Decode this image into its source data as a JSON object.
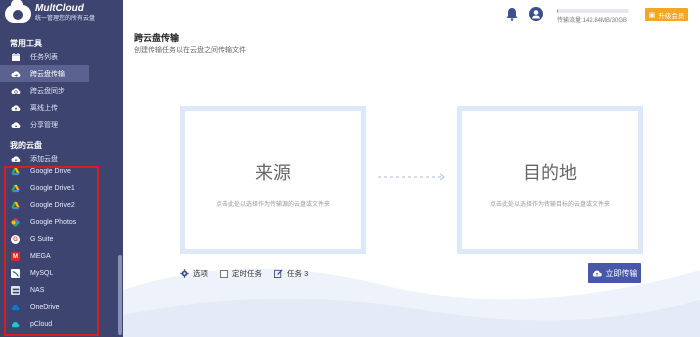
{
  "app": {
    "name": "MultCloud",
    "tagline": "统一管理您的所有云盘"
  },
  "sidebar": {
    "section_tools": "常用工具",
    "tools": [
      {
        "label": "任务列表",
        "icon": "calendar-icon"
      },
      {
        "label": "跨云盘传输",
        "icon": "cloud-transfer-icon",
        "active": true
      },
      {
        "label": "跨云盘同步",
        "icon": "cloud-sync-icon"
      },
      {
        "label": "离线上传",
        "icon": "cloud-upload-icon"
      },
      {
        "label": "分享管理",
        "icon": "share-icon"
      }
    ],
    "section_clouds": "我的云盘",
    "add_cloud": "添加云盘",
    "clouds": [
      {
        "label": "Google Drive",
        "icon": "google-drive-icon"
      },
      {
        "label": "Google Drive1",
        "icon": "google-drive-icon"
      },
      {
        "label": "Google Drive2",
        "icon": "google-drive-icon"
      },
      {
        "label": "Google Photos",
        "icon": "google-photos-icon"
      },
      {
        "label": "G Suite",
        "icon": "g-suite-icon"
      },
      {
        "label": "MEGA",
        "icon": "mega-icon"
      },
      {
        "label": "MySQL",
        "icon": "mysql-icon"
      },
      {
        "label": "NAS",
        "icon": "nas-icon"
      },
      {
        "label": "OneDrive",
        "icon": "onedrive-icon"
      },
      {
        "label": "pCloud",
        "icon": "pcloud-icon"
      }
    ]
  },
  "header": {
    "traffic_text": "传输流量:142.84MB/30GB",
    "traffic_fraction": 0.005,
    "upgrade_label": "升级会员"
  },
  "page": {
    "title": "跨云盘传输",
    "subtitle": "创建传输任务以在云盘之间传输文件"
  },
  "source": {
    "title": "来源",
    "hint": "点击此处以选择作为传输源的云盘或文件夹"
  },
  "destination": {
    "title": "目的地",
    "hint": "点击此处以选择作为传输目标的云盘或文件夹"
  },
  "options": {
    "options_label": "选项",
    "schedule_label": "定时任务",
    "task_label": "任务 3"
  },
  "transfer_button": "立即传输",
  "colors": {
    "sidebar": "#3d4470",
    "accent": "#4857a8",
    "upgrade": "#f5a623",
    "highlight_box": "#d91c1c"
  }
}
